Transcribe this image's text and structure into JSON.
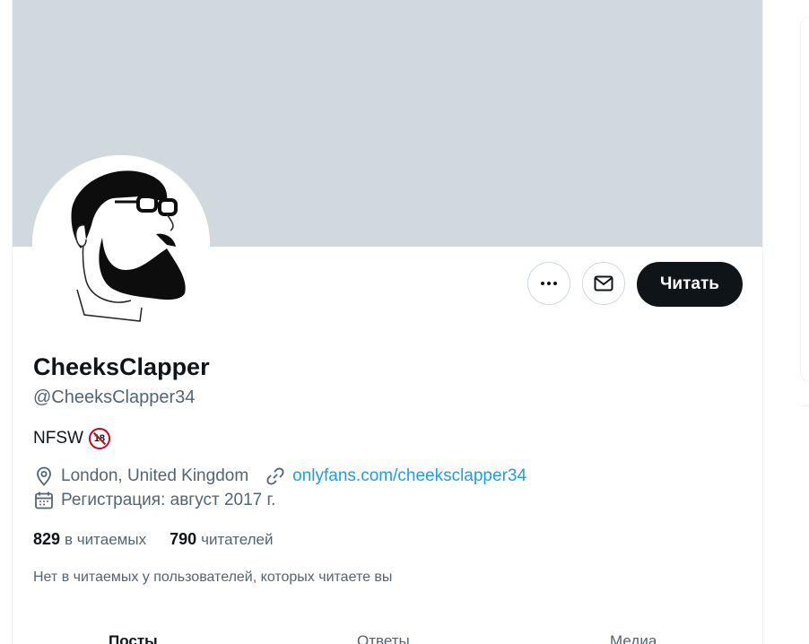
{
  "profile": {
    "display_name": "CheeksClapper",
    "handle": "@CheeksClapper34",
    "bio_text": "NFSW",
    "bio_emoji_text": "18",
    "location": "London, United Kingdom",
    "website": "onlyfans.com/cheeksclapper34",
    "joined": "Регистрация: август 2017 г."
  },
  "actions": {
    "follow_label": "Читать"
  },
  "stats": {
    "following_count": "829",
    "following_label": "в читаемых",
    "followers_count": "790",
    "followers_label": "читателей"
  },
  "note": "Нет в читаемых у пользователей, которых читаете вы",
  "tabs": [
    {
      "label": "Посты"
    },
    {
      "label": "Ответы"
    },
    {
      "label": "Медиа"
    }
  ],
  "colors": {
    "banner": "#cfd9de",
    "link": "#1d9bf0",
    "primary_button": "#0f1419",
    "secondary_text": "#536471"
  },
  "icons": [
    "more-icon",
    "mail-icon",
    "location-icon",
    "link-icon",
    "calendar-icon"
  ]
}
